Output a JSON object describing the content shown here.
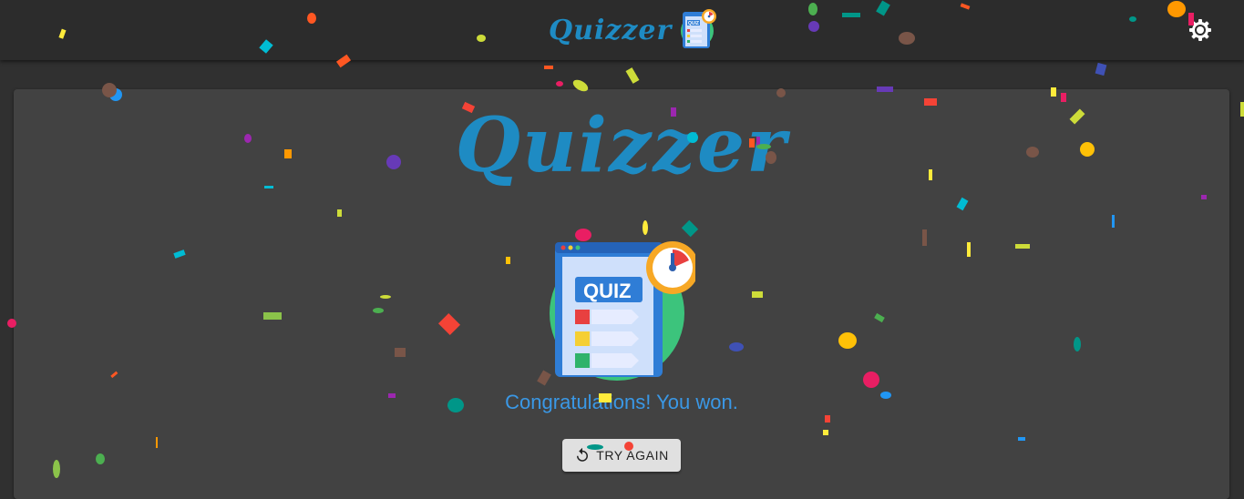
{
  "appbar": {
    "title": "Quizzer",
    "theme_toggle_icon": "brightness-icon"
  },
  "main": {
    "title": "Quizzer",
    "logo_text": "QUIZ",
    "message": "Congratulations! You won.",
    "try_again_label": "TRY AGAIN",
    "try_again_icon": "restart-icon"
  },
  "colors": {
    "brand": "#1e8bc3",
    "message": "#3a98e6",
    "background": "#303030",
    "card": "#424242",
    "appbar": "#2c2c2c",
    "button": "#e0e0e0"
  }
}
